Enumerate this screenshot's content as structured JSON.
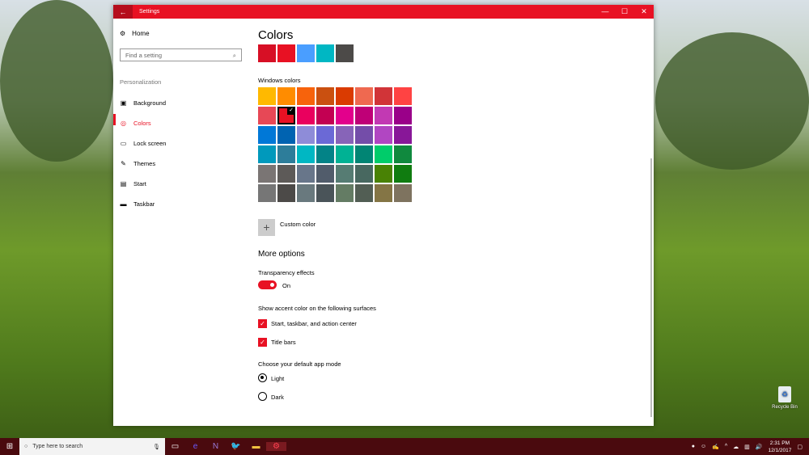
{
  "window": {
    "title": "Settings",
    "minimize": "—",
    "maximize": "☐",
    "close": "✕",
    "back": "←"
  },
  "nav": {
    "home": "Home",
    "search_placeholder": "Find a setting",
    "section": "Personalization",
    "items": [
      {
        "label": "Background",
        "icon": "▣"
      },
      {
        "label": "Colors",
        "icon": "◎"
      },
      {
        "label": "Lock screen",
        "icon": "▭"
      },
      {
        "label": "Themes",
        "icon": "✎"
      },
      {
        "label": "Start",
        "icon": "▤"
      },
      {
        "label": "Taskbar",
        "icon": "▬"
      }
    ]
  },
  "main": {
    "title": "Colors",
    "recent_colors": [
      "#d70f25",
      "#e81123",
      "#4a9eff",
      "#00b7c3",
      "#4c4a48"
    ],
    "windows_colors_label": "Windows colors",
    "palette": [
      "#FFB900",
      "#FF8C00",
      "#F7630C",
      "#CA5010",
      "#DA3B01",
      "#EF6950",
      "#D13438",
      "#FF4343",
      "#E74856",
      "#E81123",
      "#EA005E",
      "#C30052",
      "#E3008C",
      "#BF0077",
      "#C239B3",
      "#9A0089",
      "#0078D7",
      "#0063B1",
      "#8E8CD8",
      "#6B69D6",
      "#8764B8",
      "#744DA9",
      "#B146C2",
      "#881798",
      "#0099BC",
      "#2D7D9A",
      "#00B7C3",
      "#038387",
      "#00B294",
      "#018574",
      "#00CC6A",
      "#10893E",
      "#7A7574",
      "#5D5A58",
      "#68768A",
      "#515C6B",
      "#567C73",
      "#486860",
      "#498205",
      "#107C10",
      "#767676",
      "#4C4A48",
      "#69797E",
      "#4A5459",
      "#647C64",
      "#525E54",
      "#847545",
      "#7E735F"
    ],
    "selected_index": 9,
    "custom_color": "Custom color",
    "more_options": "More options",
    "transparency_label": "Transparency effects",
    "transparency_state": "On",
    "accent_label": "Show accent color on the following surfaces",
    "accent_start": "Start, taskbar, and action center",
    "accent_titlebars": "Title bars",
    "mode_label": "Choose your default app mode",
    "mode_light": "Light",
    "mode_dark": "Dark"
  },
  "taskbar": {
    "search_placeholder": "Type here to search",
    "time": "2:31 PM",
    "date": "12/1/2017"
  },
  "desktop": {
    "recycle_bin": "Recycle Bin"
  },
  "accent": "#e81123"
}
